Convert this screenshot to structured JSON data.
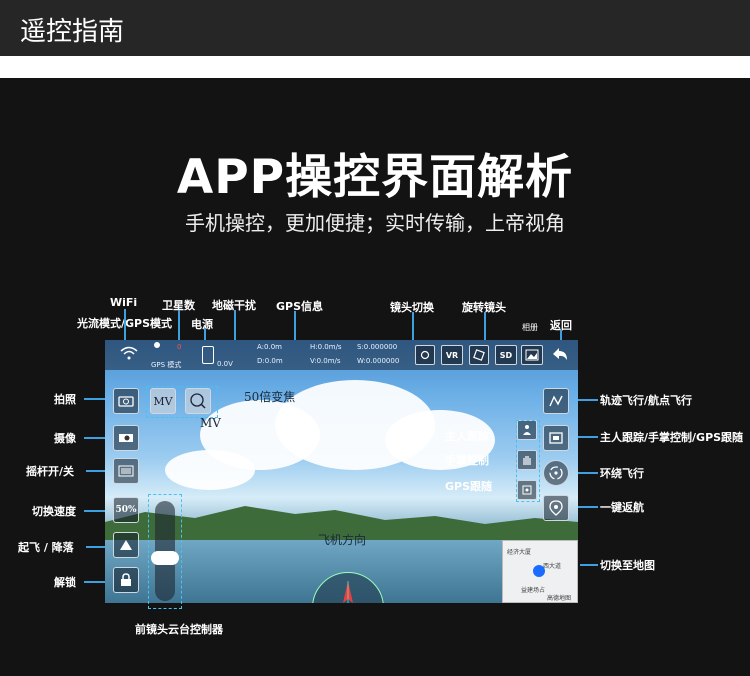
{
  "header": {
    "title": "遥控指南"
  },
  "hero": {
    "headline": "APP操控界面解析",
    "subline": "手机操控，更加便捷；实时传输，上帝视角"
  },
  "top_labels": {
    "wifi": "WiFi",
    "flow_gps_mode": "光流模式/GPS模式",
    "satellites": "卫星数",
    "power": "电源",
    "magnetic": "地磁干扰",
    "gps_info": "GPS信息",
    "lens_switch": "镜头切换",
    "rotate_lens": "旋转镜头",
    "album": "相册",
    "back": "返回"
  },
  "left_labels": {
    "photo": "拍照",
    "video": "摄像",
    "joystick": "摇杆开/关",
    "speed": "切换速度",
    "takeoff_land": "起飞 / 降落",
    "unlock": "解锁"
  },
  "right_labels": {
    "waypoint": "轨迹飞行/航点飞行",
    "follow_modes": "主人跟踪/手掌控制/GPS跟随",
    "orbit": "环绕飞行",
    "return_home": "一键返航",
    "switch_map": "切换至地图"
  },
  "inner_labels": {
    "owner_track": "主人跟踪",
    "palm_control": "手掌控制",
    "gps_follow": "GPS跟随",
    "zoom": "50倍变焦",
    "mv": "MV",
    "heading": "飞机方向",
    "gimbal": "前镜头云台控制器"
  },
  "status_bar": {
    "mode": "GPS 模式",
    "sat_count": "0",
    "voltage": "0.0V",
    "a": "A:0.0m",
    "d": "D:0.0m",
    "h": "H:0.0m/s",
    "v": "V:0.0m/s",
    "s": "S:0.000000",
    "w": "W:0.000000"
  },
  "buttons": {
    "speed_value": "50%",
    "mv_button": "MV",
    "zoom_button": "x50",
    "vr": "VR",
    "sd": "SD"
  },
  "map": {
    "place1": "经济大厦",
    "place2": "西大道",
    "place3": "高德地图",
    "place4": "益建场占"
  },
  "colors": {
    "accent_line": "#3fa0e0",
    "dashed": "#4cc0f0"
  }
}
